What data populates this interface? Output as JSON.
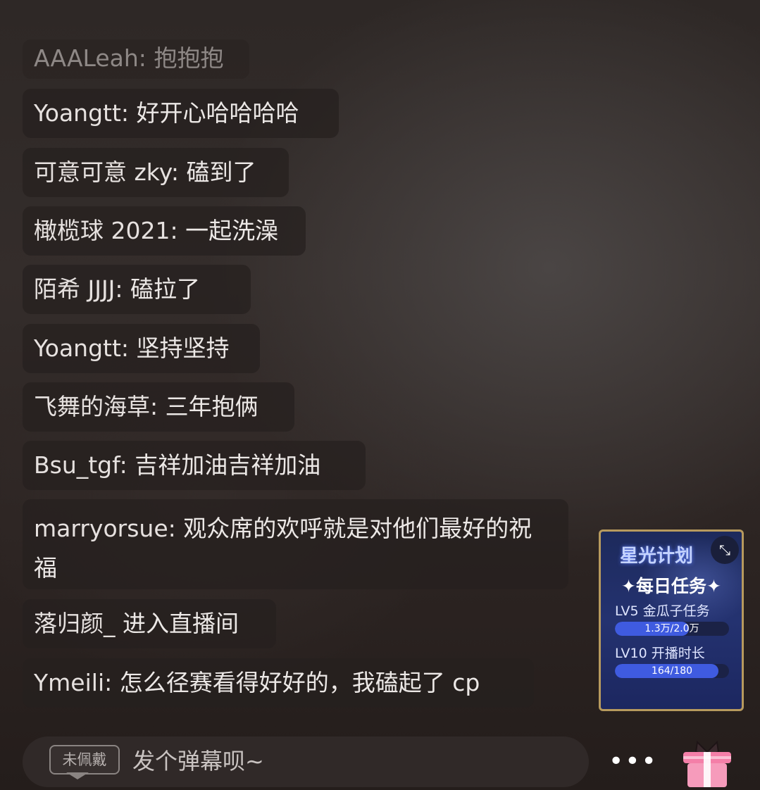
{
  "chat": {
    "messages": [
      {
        "user": "AAALeah:",
        "text": "抱抱抱"
      },
      {
        "user": "Yoangtt:",
        "text": "好开心哈哈哈哈"
      },
      {
        "user": "可意可意 zky:",
        "text": "磕到了"
      },
      {
        "user": "橄榄球 2021:",
        "text": "一起洗澡"
      },
      {
        "user": "陌希 JJJJ:",
        "text": "磕拉了"
      },
      {
        "user": "Yoangtt:",
        "text": "坚持坚持"
      },
      {
        "user": "飞舞的海草:",
        "text": "三年抱俩"
      },
      {
        "user": "Bsu_tgf:",
        "text": "吉祥加油吉祥加油"
      },
      {
        "user": "marryorsue:",
        "text": "观众席的欢呼就是对他们最好的祝福"
      },
      {
        "user": "落归颜_",
        "text": "进入直播间"
      },
      {
        "user": "Ymeili:",
        "text": "怎么径赛看得好好的，我磕起了 cp"
      }
    ]
  },
  "widget": {
    "title": "星光计划",
    "subtitle": "✦每日任务✦",
    "tasks": [
      {
        "label": "LV5 金瓜子任务",
        "progress_text": "1.3万/2.0万",
        "progress": 0.65
      },
      {
        "label": "LV10 开播时长",
        "progress_text": "164/180",
        "progress": 0.91
      }
    ],
    "collapse_icon": "collapse-arrows-icon"
  },
  "input": {
    "badge_label": "未佩戴",
    "placeholder": "发个弹幕呗~"
  },
  "controls": {
    "more_icon": "more-dots-icon",
    "more_label": "•••",
    "gift_icon": "gift-icon"
  },
  "colors": {
    "widget_bg": "#243270",
    "widget_border": "#b79a5e",
    "progress_fill": "#3f5be0",
    "gift_pink": "#f47fa8"
  }
}
